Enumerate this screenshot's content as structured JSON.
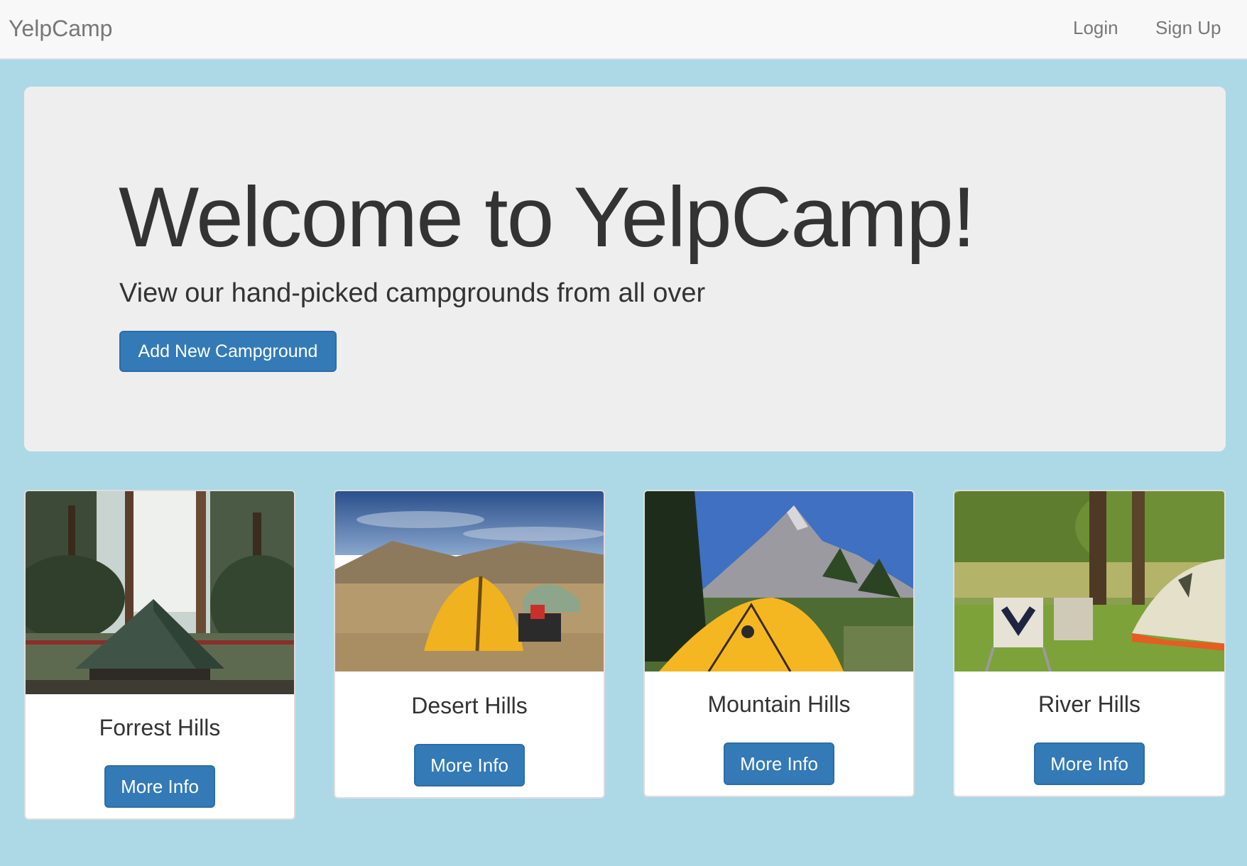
{
  "navbar": {
    "brand": "YelpCamp",
    "links": [
      {
        "label": "Login"
      },
      {
        "label": "Sign Up"
      }
    ]
  },
  "jumbotron": {
    "title": "Welcome to YelpCamp!",
    "subtitle": "View our hand-picked campgrounds from all over",
    "add_button": "Add New Campground"
  },
  "campgrounds": [
    {
      "name": "Forrest Hills",
      "button": "More Info",
      "image": "forest-tent-photo"
    },
    {
      "name": "Desert Hills",
      "button": "More Info",
      "image": "desert-tents-photo"
    },
    {
      "name": "Mountain Hills",
      "button": "More Info",
      "image": "mountain-tent-photo"
    },
    {
      "name": "River Hills",
      "button": "More Info",
      "image": "river-camp-chairs-photo"
    }
  ],
  "colors": {
    "page_background": "#add8e6",
    "navbar_background": "#f8f8f8",
    "jumbotron_background": "#eeeeee",
    "primary_button": "#337ab7"
  }
}
